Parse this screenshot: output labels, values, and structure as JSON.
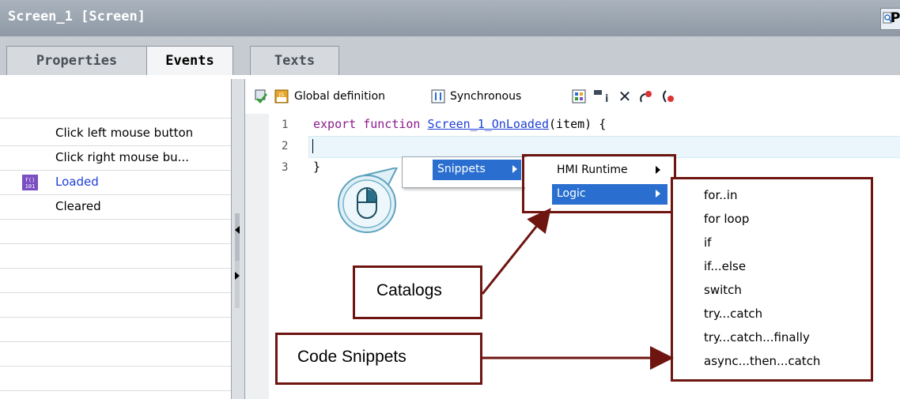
{
  "window": {
    "title": "Screen_1 [Screen]",
    "right_button_label": "P"
  },
  "tabs": [
    {
      "label": "Properties"
    },
    {
      "label": "Events"
    },
    {
      "label": "Texts"
    }
  ],
  "events": {
    "items": [
      "Click left mouse button",
      "Click right mouse bu...",
      "Loaded",
      "Cleared"
    ]
  },
  "toolbar": {
    "global_definition": "Global definition",
    "synchronous": "Synchronous"
  },
  "editor": {
    "line_numbers": [
      "1",
      "2",
      "3"
    ],
    "line1_keyword": "export function",
    "line1_name": "Screen_1_OnLoaded",
    "line1_args": "(item) {",
    "line3": "}"
  },
  "context_menu": {
    "snippets": "Snippets"
  },
  "submenu": {
    "hmi_runtime": "HMI Runtime",
    "logic": "Logic"
  },
  "snippets": [
    "for..in",
    "for loop",
    "if",
    "if...else",
    "switch",
    "try...catch",
    "try...catch...finally",
    "async...then...catch"
  ],
  "callouts": {
    "catalogs": "Catalogs",
    "code_snippets": "Code Snippets"
  },
  "colors": {
    "accent": "#2a6fcf",
    "callout_border": "#6e1512",
    "keyword": "#8b1a8b",
    "function_name": "#1f3fd6"
  }
}
